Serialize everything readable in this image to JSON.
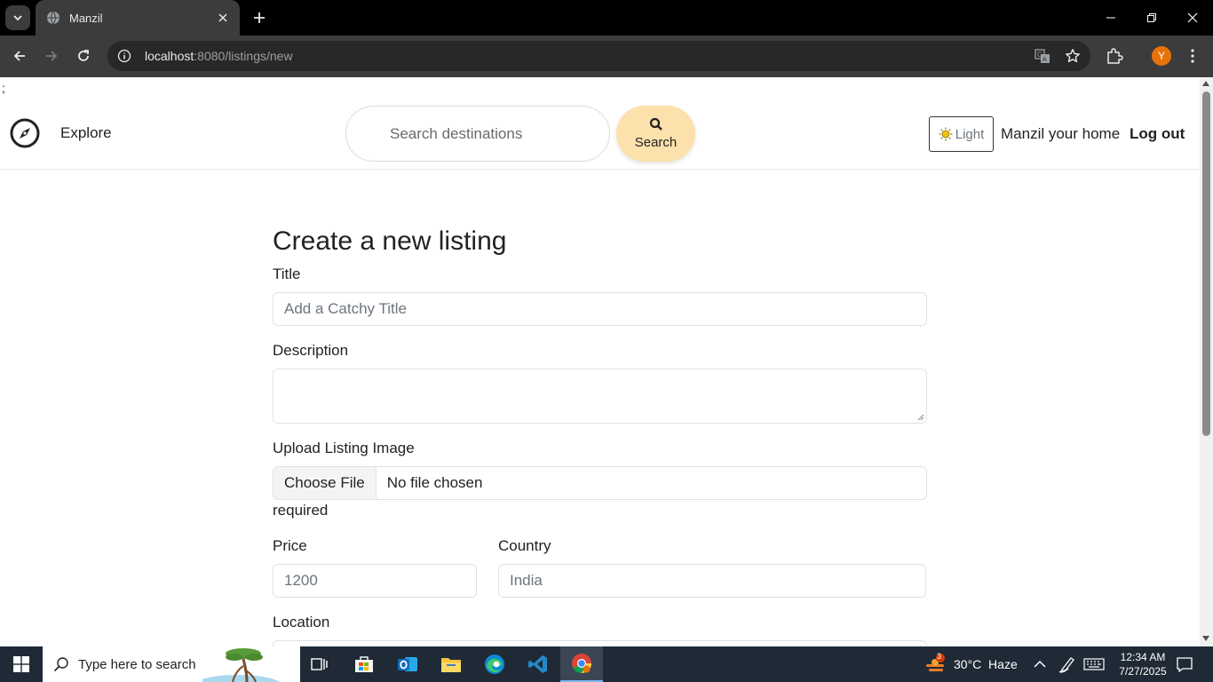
{
  "browser": {
    "tab_title": "Manzil",
    "url_host": "localhost",
    "url_rest": ":8080/listings/new",
    "profile_initial": "Y"
  },
  "page": {
    "stray_text": ";",
    "navbar": {
      "explore_label": "Explore",
      "search_placeholder": "Search destinations",
      "search_button_label": "Search",
      "theme_label": "Light",
      "host_link": "Manzil your home",
      "logout_link": "Log out"
    },
    "form": {
      "heading": "Create a new listing",
      "title_label": "Title",
      "title_placeholder": "Add a Catchy Title",
      "description_label": "Description",
      "image_label": "Upload Listing Image",
      "choose_file_label": "Choose File",
      "file_status": "No file chosen",
      "image_required_note": "required",
      "price_label": "Price",
      "price_placeholder": "1200",
      "country_label": "Country",
      "country_placeholder": "India",
      "location_label": "Location"
    }
  },
  "taskbar": {
    "search_placeholder": "Type here to search",
    "weather": "30°C  Haze",
    "weather_badge": "3",
    "time": "12:34 AM",
    "date": "7/27/2025"
  },
  "colors": {
    "search_button_bg": "#fde1ad",
    "chrome_dark": "#3c3c3c",
    "taskbar_bg": "#1f2a36"
  }
}
